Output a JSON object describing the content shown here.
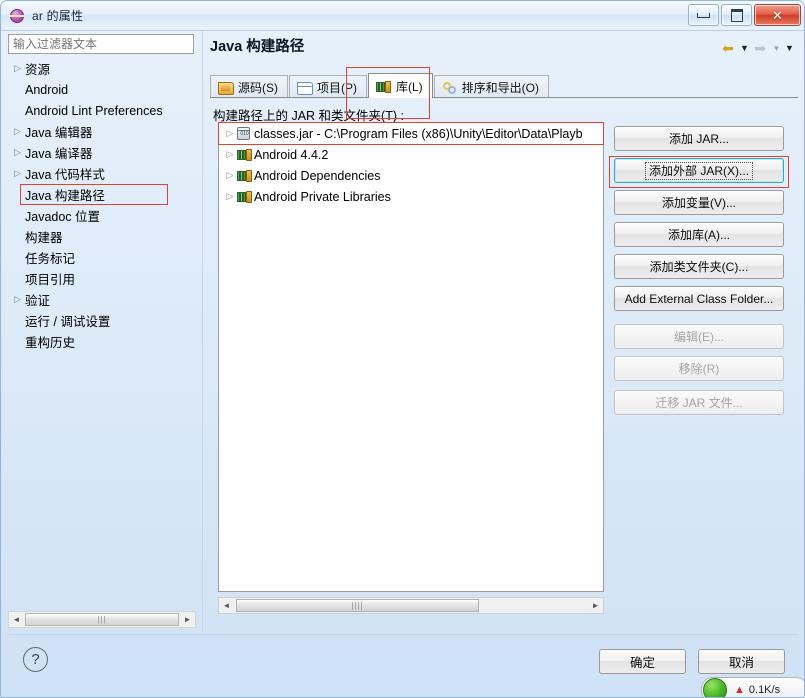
{
  "window": {
    "title": "ar 的属性",
    "icon": "eclipse-globe-icon",
    "minimize_label": "最小化",
    "maximize_label": "最大化",
    "close_label": "关闭"
  },
  "sidebar": {
    "filter_placeholder": "输入过滤器文本",
    "filter_value": "",
    "items": [
      {
        "label": "资源",
        "expandable": true,
        "selected": false
      },
      {
        "label": "Android",
        "expandable": false,
        "selected": false
      },
      {
        "label": "Android Lint Preferences",
        "expandable": false,
        "selected": false
      },
      {
        "label": "Java 编辑器",
        "expandable": true,
        "selected": false
      },
      {
        "label": "Java 编译器",
        "expandable": true,
        "selected": false
      },
      {
        "label": "Java 代码样式",
        "expandable": true,
        "selected": false
      },
      {
        "label": "Java 构建路径",
        "expandable": false,
        "selected": true
      },
      {
        "label": "Javadoc 位置",
        "expandable": false,
        "selected": false
      },
      {
        "label": "构建器",
        "expandable": false,
        "selected": false
      },
      {
        "label": "任务标记",
        "expandable": false,
        "selected": false
      },
      {
        "label": "项目引用",
        "expandable": false,
        "selected": false
      },
      {
        "label": "验证",
        "expandable": true,
        "selected": false
      },
      {
        "label": "运行 / 调试设置",
        "expandable": false,
        "selected": false
      },
      {
        "label": "重构历史",
        "expandable": false,
        "selected": false
      }
    ],
    "scrollbar": {
      "left_arrow": "◄",
      "right_arrow": "►",
      "grip": "|||"
    }
  },
  "panel": {
    "page_title": "Java 构建路径",
    "nav": {
      "back_icon": "back-arrow-icon",
      "back_dropdown_icon": "chevron-down-icon",
      "forward_icon": "forward-arrow-icon",
      "forward_dropdown_icon": "chevron-down-icon",
      "menu_dropdown_icon": "chevron-down-icon"
    },
    "tabs": [
      {
        "label": "源码(S)",
        "icon": "source-folder-icon",
        "active": false
      },
      {
        "label": "项目(P)",
        "icon": "project-folder-icon",
        "active": false
      },
      {
        "label": "库(L)",
        "icon": "library-icon",
        "active": true
      },
      {
        "label": "排序和导出(O)",
        "icon": "order-export-icon",
        "active": false
      }
    ],
    "list_caption": "构建路径上的 JAR 和类文件夹(T) :",
    "entries": [
      {
        "label": "classes.jar  -  C:\\Program Files (x86)\\Unity\\Editor\\Data\\Playb",
        "icon": "jar-file-icon",
        "expandable": true,
        "highlighted": true
      },
      {
        "label": "Android 4.4.2",
        "icon": "library-icon",
        "expandable": true,
        "highlighted": false
      },
      {
        "label": "Android Dependencies",
        "icon": "library-icon",
        "expandable": true,
        "highlighted": false
      },
      {
        "label": "Android Private Libraries",
        "icon": "library-icon",
        "expandable": true,
        "highlighted": false
      }
    ],
    "list_scrollbar": {
      "left_arrow": "◄",
      "right_arrow": "►",
      "grip": "||||"
    },
    "buttons": [
      {
        "label": "添加 JAR...",
        "state": "enabled",
        "focused": false
      },
      {
        "label": "添加外部 JAR(X)...",
        "state": "enabled",
        "focused": true
      },
      {
        "label": "添加变量(V)...",
        "state": "enabled",
        "focused": false
      },
      {
        "label": "添加库(A)...",
        "state": "enabled",
        "focused": false
      },
      {
        "label": "添加类文件夹(C)...",
        "state": "enabled",
        "focused": false
      },
      {
        "label": "Add External Class Folder...",
        "state": "enabled",
        "focused": false
      },
      {
        "label": "编辑(E)...",
        "state": "disabled",
        "focused": false
      },
      {
        "label": "移除(R)",
        "state": "disabled",
        "focused": false
      },
      {
        "label": "迁移 JAR 文件...",
        "state": "disabled",
        "focused": false
      }
    ]
  },
  "footer": {
    "help_icon": "help-question-icon",
    "ok_label": "确定",
    "cancel_label": "取消"
  },
  "overlay": {
    "network_speed": "0.1K/s",
    "upload_arrow": "▲",
    "orb_icon": "green-orb-icon"
  },
  "annotations": {
    "highlight_color": "#e0422f",
    "focus_color": "#3aa9c4"
  }
}
